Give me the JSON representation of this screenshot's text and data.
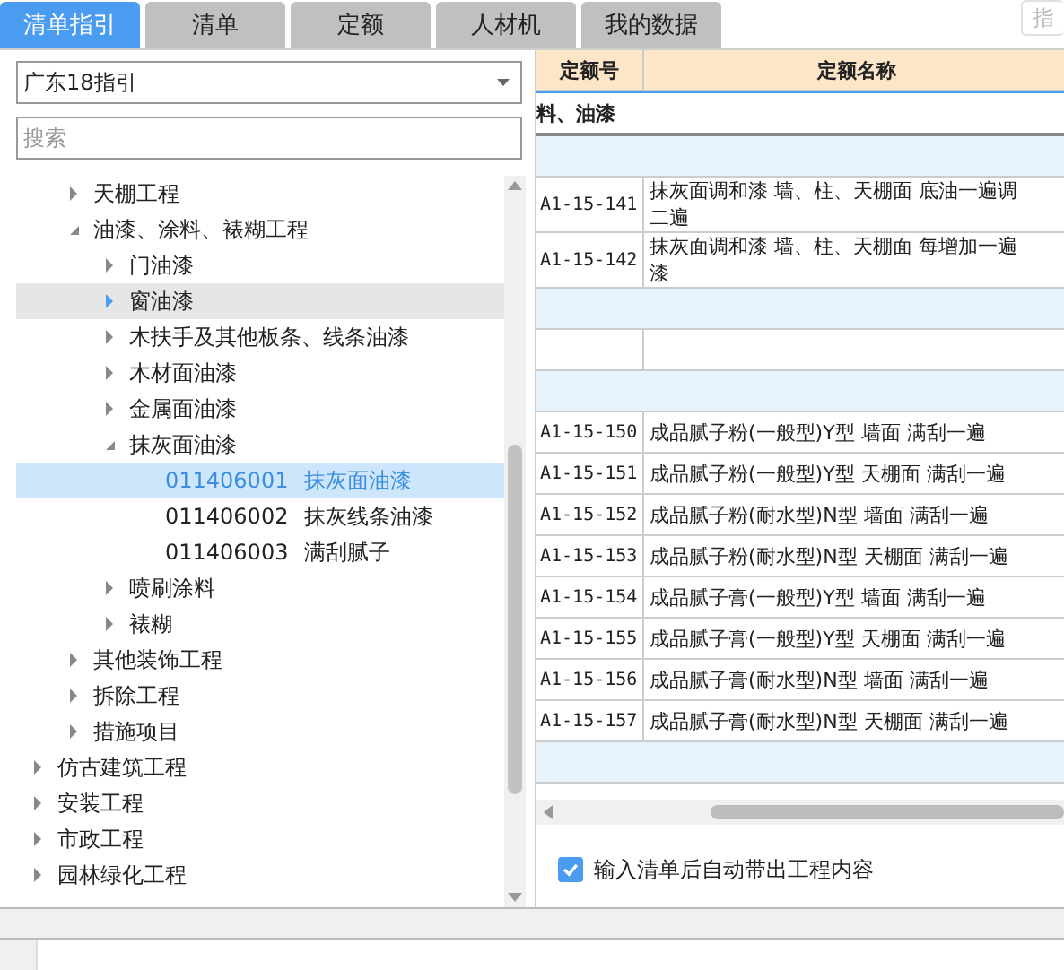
{
  "tabs": [
    {
      "label": "清单指引",
      "selected": true
    },
    {
      "label": "清单",
      "selected": false
    },
    {
      "label": "定额",
      "selected": false
    },
    {
      "label": "人材机",
      "selected": false
    },
    {
      "label": "我的数据",
      "selected": false
    }
  ],
  "top_right_button": {
    "label": "指"
  },
  "left_panel": {
    "dropdown": {
      "value": "广东18指引"
    },
    "search": {
      "placeholder": "搜索"
    },
    "tree": [
      {
        "children": [
          {
            "label": "天棚工程",
            "expanded": false,
            "selected": false,
            "hovered": false
          },
          {
            "label": "油漆、涂料、裱糊工程",
            "expanded": true,
            "selected": false,
            "hovered": false,
            "children": [
              {
                "label": "门油漆",
                "expanded": false,
                "selected": false,
                "hovered": false
              },
              {
                "label": "窗油漆",
                "expanded": false,
                "selected": false,
                "hovered": true
              },
              {
                "label": "木扶手及其他板条、线条油漆",
                "expanded": false,
                "selected": false,
                "hovered": false
              },
              {
                "label": "木材面油漆",
                "expanded": false,
                "selected": false,
                "hovered": false
              },
              {
                "label": "金属面油漆",
                "expanded": false,
                "selected": false,
                "hovered": false
              },
              {
                "label": "抹灰面油漆",
                "expanded": true,
                "selected": false,
                "hovered": false,
                "children": [
                  {
                    "code": "011406001",
                    "label": "抹灰面油漆",
                    "selected": true,
                    "hovered": false
                  },
                  {
                    "code": "011406002",
                    "label": "抹灰线条油漆",
                    "selected": false,
                    "hovered": false
                  },
                  {
                    "code": "011406003",
                    "label": "满刮腻子",
                    "selected": false,
                    "hovered": false
                  }
                ]
              },
              {
                "label": "喷刷涂料",
                "expanded": false,
                "selected": false,
                "hovered": false
              },
              {
                "label": "裱糊",
                "expanded": false,
                "selected": false,
                "hovered": false
              }
            ]
          },
          {
            "label": "其他装饰工程",
            "expanded": false,
            "selected": false,
            "hovered": false
          },
          {
            "label": "拆除工程",
            "expanded": false,
            "selected": false,
            "hovered": false
          },
          {
            "label": "措施项目",
            "expanded": false,
            "selected": false,
            "hovered": false
          }
        ]
      },
      {
        "label": "仿古建筑工程",
        "expanded": false,
        "selected": false,
        "hovered": false
      },
      {
        "label": "安装工程",
        "expanded": false,
        "selected": false,
        "hovered": false
      },
      {
        "label": "市政工程",
        "expanded": false,
        "selected": false,
        "hovered": false
      },
      {
        "label": "园林绿化工程",
        "expanded": false,
        "selected": false,
        "hovered": false
      }
    ]
  },
  "grid": {
    "columns": [
      "定额号",
      "定额名称"
    ],
    "rows": [
      {
        "kind": "group",
        "title": "料、油漆"
      },
      {
        "kind": "section"
      },
      {
        "kind": "item",
        "code": "A1-15-141",
        "name": [
          "抹灰面调和漆 墙、柱、天棚面 底油一遍调",
          "二遍"
        ]
      },
      {
        "kind": "item",
        "code": "A1-15-142",
        "name": [
          "抹灰面调和漆 墙、柱、天棚面 每增加一遍",
          "漆"
        ]
      },
      {
        "kind": "section"
      },
      {
        "kind": "blank"
      },
      {
        "kind": "section"
      },
      {
        "kind": "item",
        "code": "A1-15-150",
        "name": [
          "成品腻子粉(一般型)Y型 墙面 满刮一遍"
        ]
      },
      {
        "kind": "item",
        "code": "A1-15-151",
        "name": [
          "成品腻子粉(一般型)Y型 天棚面 满刮一遍"
        ]
      },
      {
        "kind": "item",
        "code": "A1-15-152",
        "name": [
          "成品腻子粉(耐水型)N型 墙面 满刮一遍"
        ]
      },
      {
        "kind": "item",
        "code": "A1-15-153",
        "name": [
          "成品腻子粉(耐水型)N型 天棚面 满刮一遍"
        ]
      },
      {
        "kind": "item",
        "code": "A1-15-154",
        "name": [
          "成品腻子膏(一般型)Y型 墙面 满刮一遍"
        ]
      },
      {
        "kind": "item",
        "code": "A1-15-155",
        "name": [
          "成品腻子膏(一般型)Y型 天棚面 满刮一遍"
        ]
      },
      {
        "kind": "item",
        "code": "A1-15-156",
        "name": [
          "成品腻子膏(耐水型)N型 墙面 满刮一遍"
        ]
      },
      {
        "kind": "item",
        "code": "A1-15-157",
        "name": [
          "成品腻子膏(耐水型)N型 天棚面 满刮一遍"
        ]
      },
      {
        "kind": "section"
      }
    ]
  },
  "options": {
    "auto_fill": {
      "label": "输入清单后自动带出工程内容",
      "checked": true
    }
  }
}
